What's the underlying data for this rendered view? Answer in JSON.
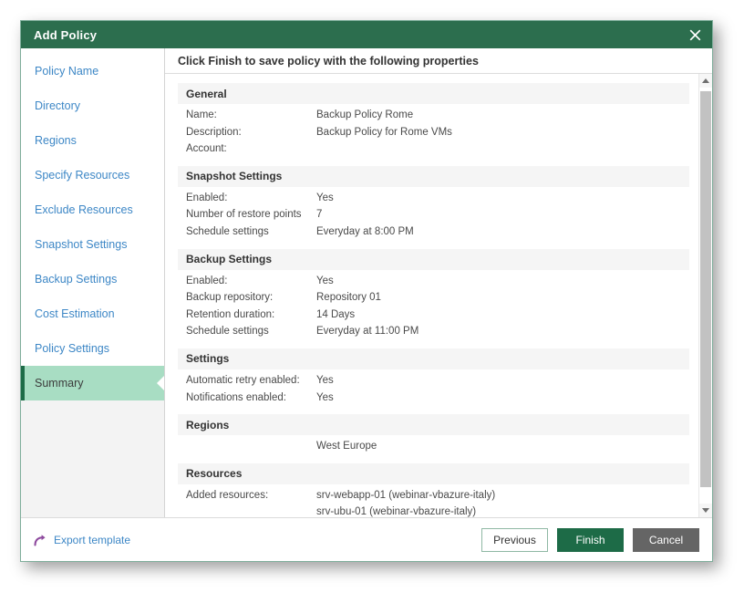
{
  "window": {
    "title": "Add Policy",
    "close_icon": "close-icon"
  },
  "sidebar": {
    "items": [
      {
        "label": "Policy Name",
        "active": false
      },
      {
        "label": "Directory",
        "active": false
      },
      {
        "label": "Regions",
        "active": false
      },
      {
        "label": "Specify Resources",
        "active": false
      },
      {
        "label": "Exclude Resources",
        "active": false
      },
      {
        "label": "Snapshot Settings",
        "active": false
      },
      {
        "label": "Backup Settings",
        "active": false
      },
      {
        "label": "Cost Estimation",
        "active": false
      },
      {
        "label": "Policy Settings",
        "active": false
      },
      {
        "label": "Summary",
        "active": true
      }
    ]
  },
  "content": {
    "header": "Click Finish to save policy with the following properties",
    "sections": [
      {
        "title": "General",
        "rows": [
          {
            "label": "Name:",
            "value": "Backup Policy Rome"
          },
          {
            "label": "Description:",
            "value": "Backup Policy for Rome VMs"
          },
          {
            "label": "Account:",
            "value": ""
          }
        ]
      },
      {
        "title": "Snapshot Settings",
        "rows": [
          {
            "label": "Enabled:",
            "value": "Yes"
          },
          {
            "label": "Number of restore points",
            "value": "7"
          },
          {
            "label": "Schedule settings",
            "value": "Everyday at 8:00 PM"
          }
        ]
      },
      {
        "title": "Backup Settings",
        "rows": [
          {
            "label": "Enabled:",
            "value": "Yes"
          },
          {
            "label": "Backup repository:",
            "value": "Repository 01"
          },
          {
            "label": "Retention duration:",
            "value": "14 Days"
          },
          {
            "label": "Schedule settings",
            "value": "Everyday at 11:00 PM"
          }
        ]
      },
      {
        "title": "Settings",
        "rows": [
          {
            "label": "Automatic retry enabled:",
            "value": "Yes"
          },
          {
            "label": "Notifications enabled:",
            "value": "Yes"
          }
        ]
      },
      {
        "title": "Regions",
        "rows": [
          {
            "label": "",
            "value": "West Europe"
          }
        ]
      },
      {
        "title": "Resources",
        "rows": [
          {
            "label": "Added resources:",
            "value": "srv-webapp-01 (webinar-vbazure-italy)\nsrv-ubu-01 (webinar-vbazure-italy)"
          }
        ]
      }
    ]
  },
  "scrollbar": {
    "up_icon": "scroll-up-arrow-icon",
    "down_icon": "scroll-down-arrow-icon"
  },
  "footer": {
    "export_label": "Export template",
    "export_icon": "share-arrow-icon",
    "previous_label": "Previous",
    "finish_label": "Finish",
    "cancel_label": "Cancel"
  },
  "colors": {
    "titlebar_green": "#2c6e4e",
    "accent_green": "#1d6b47",
    "active_nav_green": "#a8ddc3",
    "link_blue": "#3d87c6",
    "cancel_grey": "#656565",
    "section_band": "#f5f5f5",
    "export_icon_purple": "#8e4a9e"
  }
}
